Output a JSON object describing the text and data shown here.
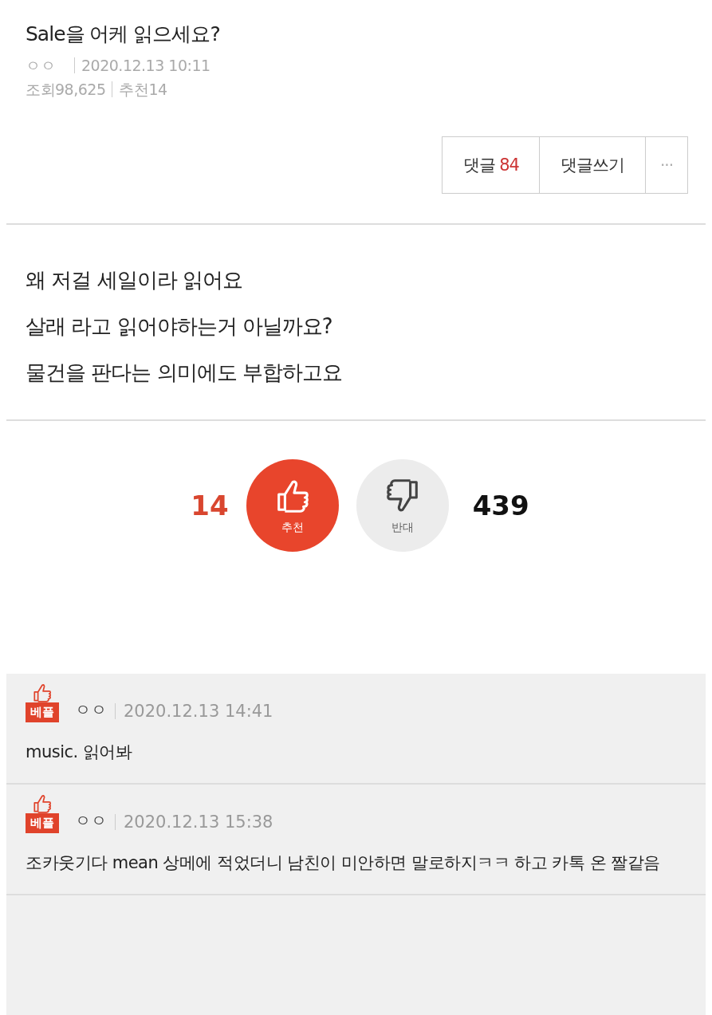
{
  "post": {
    "title": "Sale을 어케 읽으세요?",
    "author": "ㅇㅇ",
    "datetime": "2020.12.13 10:11",
    "views": "조회98,625",
    "recommend": "추천14"
  },
  "actions": [
    {
      "kind": "comments",
      "label": "댓글",
      "count": "84"
    },
    {
      "kind": "write",
      "label": "댓글쓰기"
    },
    {
      "kind": "more",
      "label": "···"
    }
  ],
  "body": [
    "왜 저걸 세일이라 읽어요",
    "살래 라고 읽어야하는거 아닐까요?",
    "물건을 판다는 의미에도 부합하고요"
  ],
  "votes": {
    "up_count": "14",
    "up_label": "추천",
    "down_label": "반대",
    "down_count": "439"
  },
  "comments": [
    {
      "badge": "베플",
      "author": "ㅇㅇ",
      "datetime": "2020.12.13 14:41",
      "text": "music. 읽어봐"
    },
    {
      "badge": "베플",
      "author": "ㅇㅇ",
      "datetime": "2020.12.13 15:38",
      "text": "조카웃기다 mean 상메에 적었더니 남친이 미안하면 말로하지ㅋㅋ 하고 카톡 온 짤같음"
    }
  ]
}
